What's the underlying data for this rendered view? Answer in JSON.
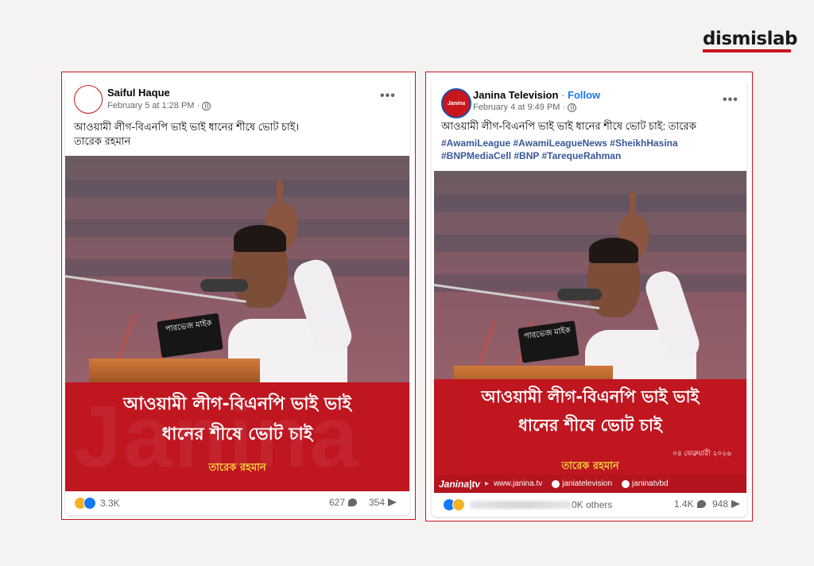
{
  "brand": {
    "logo_text": "dismislab",
    "accent": "#c8161d"
  },
  "left_post": {
    "author": "Saiful Haque",
    "timestamp": "February 5 at 1:28 PM",
    "privacy_icon": "globe-icon",
    "more_label": "•••",
    "text_line1": "আওয়ামী লীগ-বিএনপি ভাই ভাই ধানের শীষে ভোট চাই।",
    "text_line2": "তারেক রহমান",
    "image": {
      "mic_label": "পারভেজ মাইক",
      "banner_line1": "আওয়ামী লীগ-বিএনপি ভাই ভাই",
      "banner_line2": "ধানের শীষে ভোট চাই",
      "banner_name": "তারেক রহমান",
      "watermark": "Janina"
    },
    "reactions_count": "3.3K",
    "comments_count": "627",
    "shares_count": "354"
  },
  "right_post": {
    "author": "Janina Television",
    "separator": "·",
    "follow_label": "Follow",
    "timestamp": "February 4 at 9:49 PM",
    "privacy_icon": "globe-icon",
    "more_label": "•••",
    "avatar_text": "Janina",
    "text_line1": "আওয়ামী লীগ-বিএনপি ভাই ভাই ধানের শীষে ভোট চাই: তারেক",
    "hashtags_line1": "#AwamiLeague #AwamiLeagueNews #SheikhHasina",
    "hashtags_line2": "#BNPMediaCell #BNP #TarequeRahman",
    "image": {
      "mic_label": "পারভেজ মাইক",
      "banner_line1": "আওয়ামী লীগ-বিএনপি ভাই ভাই",
      "banner_line2": "ধানের শীষে ভোট চাই",
      "banner_name": "তারেক রহমান",
      "banner_date": "০৪ ফেব্রুয়ারী ২০২৬",
      "footer_brand": "Janina|tv",
      "footer_web": "www.janina.tv",
      "footer_fb": "janiatelevision",
      "footer_yt": "janinatvbd"
    },
    "reactions_text": "0K others",
    "comments_count": "1.4K",
    "shares_count": "948"
  }
}
